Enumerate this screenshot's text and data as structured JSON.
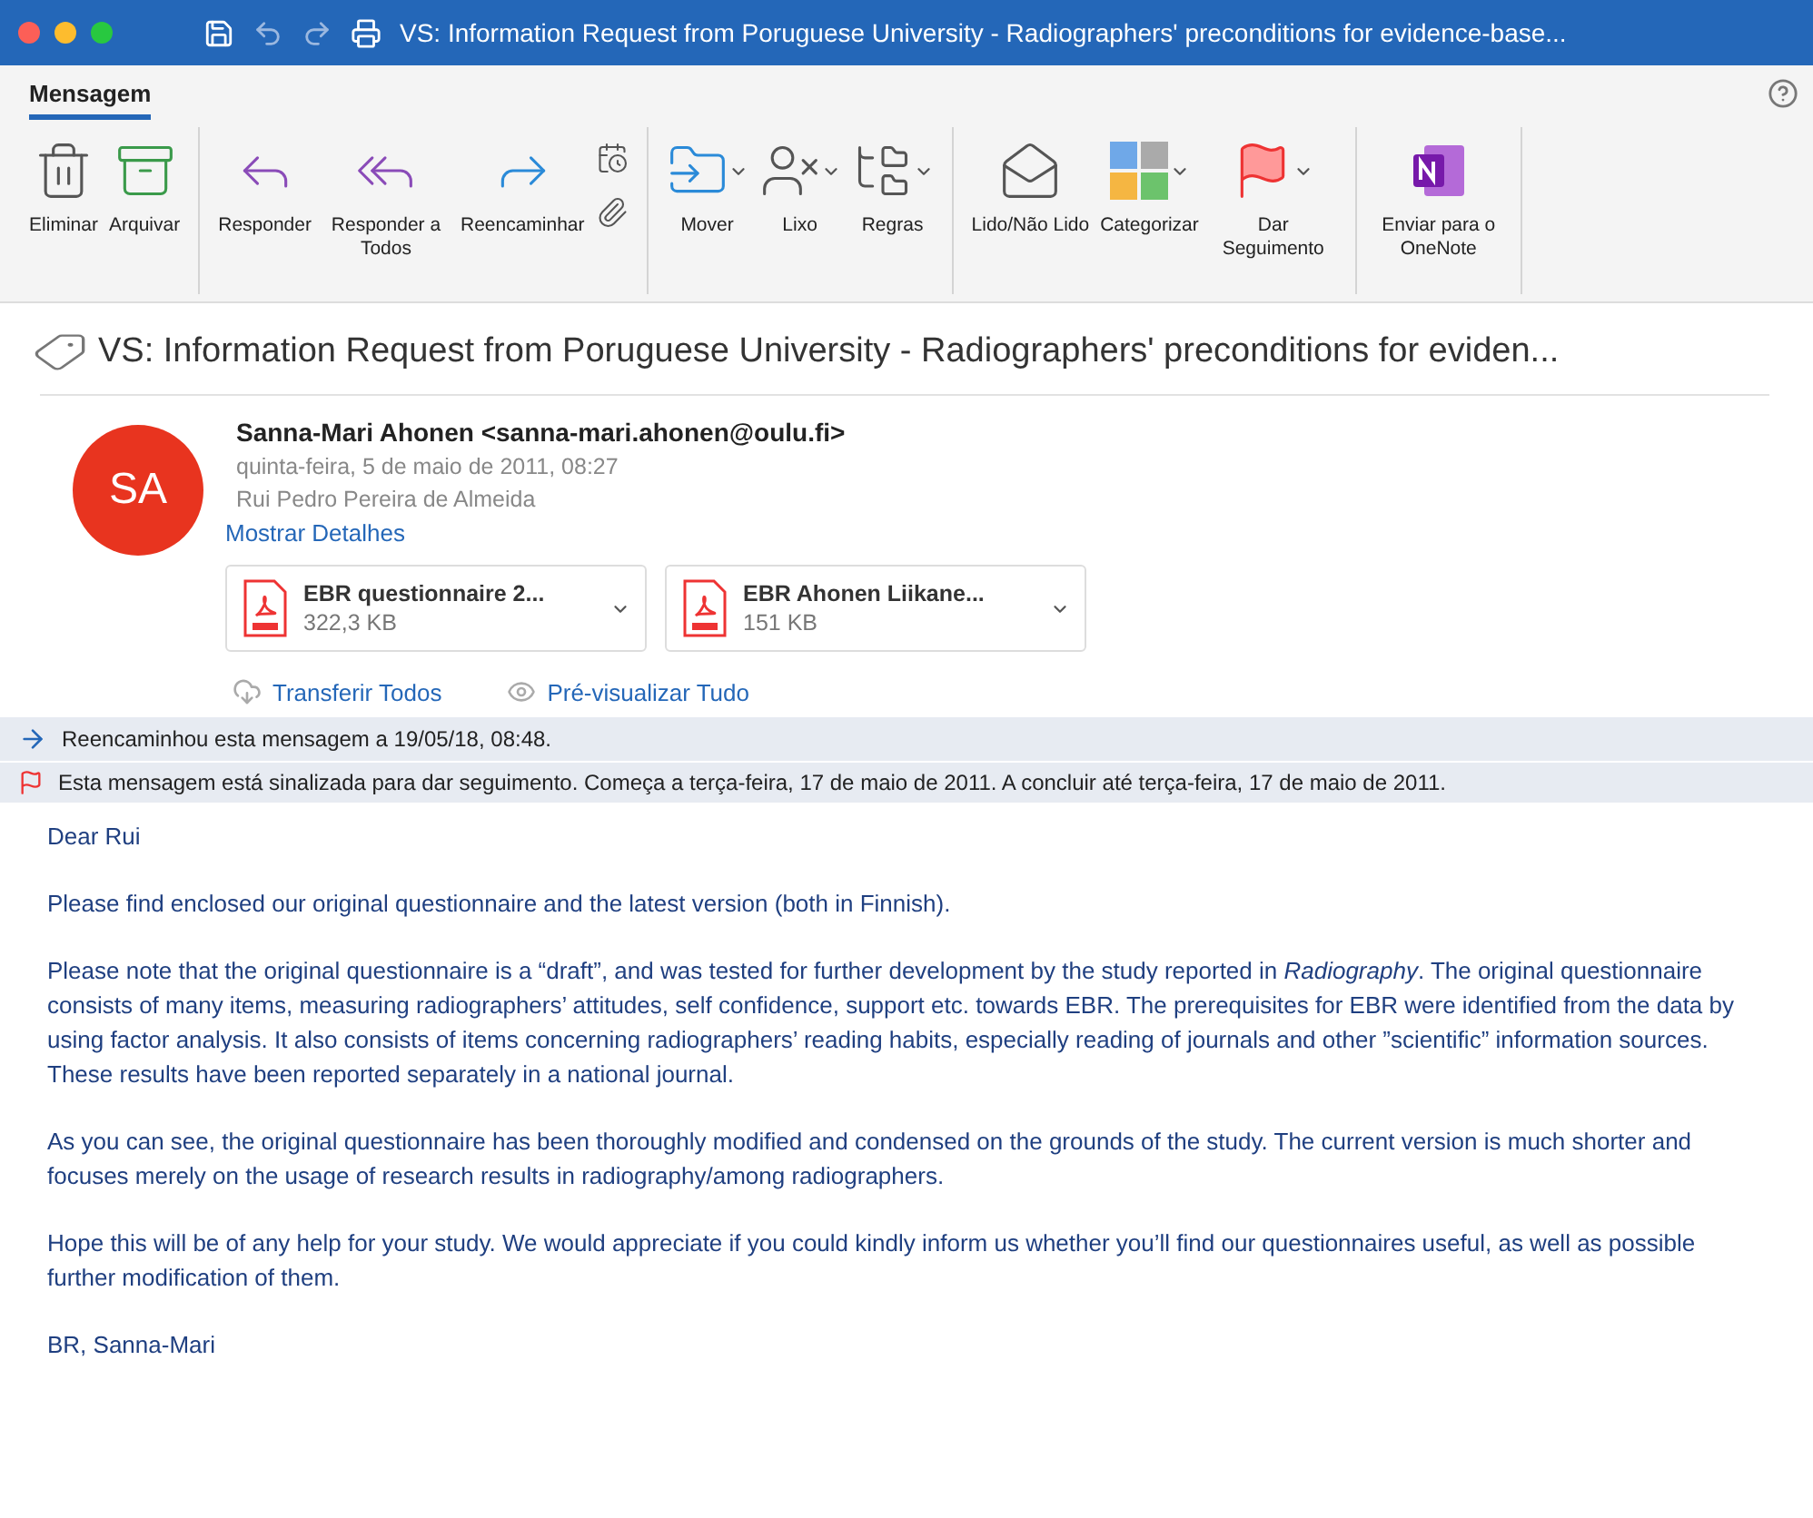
{
  "window": {
    "title": "VS: Information Request from Poruguese University - Radiographers' preconditions for evidence-base..."
  },
  "tabs": [
    {
      "label": "Mensagem",
      "selected": true
    }
  ],
  "ribbon": [
    [
      {
        "kind": "large",
        "label": "Eliminar",
        "dropdown": false
      },
      {
        "kind": "large",
        "label": "Arquivar",
        "dropdown": false
      }
    ],
    [
      {
        "kind": "large",
        "label": "Responder",
        "dropdown": false
      },
      {
        "kind": "large",
        "label": "Responder a Todos",
        "dropdown": false
      },
      {
        "kind": "large",
        "label": "Reencaminhar",
        "dropdown": false
      },
      {
        "kind": "stack"
      }
    ],
    [
      {
        "kind": "large",
        "label": "Mover",
        "dropdown": true
      },
      {
        "kind": "large",
        "label": "Lixo",
        "dropdown": true
      },
      {
        "kind": "large",
        "label": "Regras",
        "dropdown": true
      }
    ],
    [
      {
        "kind": "large",
        "label": "Lido/Não Lido",
        "dropdown": false
      },
      {
        "kind": "large",
        "label": "Categorizar",
        "dropdown": true
      },
      {
        "kind": "large",
        "label": "Dar Seguimento",
        "dropdown": true
      }
    ],
    [
      {
        "kind": "large",
        "label": "Enviar para o OneNote",
        "dropdown": false
      }
    ]
  ],
  "message": {
    "subject": "VS: Information Request from Poruguese University - Radiographers' preconditions for eviden...",
    "avatar": "SA",
    "sender": "Sanna-Mari Ahonen <sanna-mari.ahonen@oulu.fi>",
    "date": "quinta-feira, 5 de maio de 2011, 08:27",
    "to": "Rui Pedro Pereira de Almeida",
    "details_link": "Mostrar Detalhes",
    "attachments": [
      {
        "name": "EBR questionnaire 2...",
        "size": "322,3 KB"
      },
      {
        "name": "EBR Ahonen Liikane...",
        "size": "151 KB"
      }
    ],
    "actions": [
      "Transferir Todos",
      "Pré-visualizar Tudo"
    ],
    "notices": [
      {
        "kind": "forwarded",
        "text": "Reencaminhou esta mensagem a 19/05/18, 08:48."
      },
      {
        "kind": "flag",
        "text": "Esta mensagem está sinalizada para dar seguimento. Começa a terça-feira, 17 de maio de 2011. A concluir até terça-feira, 17 de maio de 2011."
      }
    ],
    "body": [
      "Dear Rui",
      "Please find enclosed our original questionnaire and the latest version (both in Finnish).",
      "Please note that the original questionnaire is a “draft”, and was tested for further development by the study reported in *Radiography*. The original questionnaire consists of many items, measuring radiographers’ attitudes, self confidence, support etc. towards EBR. The prerequisites for EBR were identified from the data by using factor analysis. It also consists of items concerning radiographers’ reading habits, especially reading of journals and other ”scientific” information sources. These results have been reported separately in a national journal.",
      "As you can see, the original questionnaire has been thoroughly modified and condensed on the grounds of the study. The current version is much shorter and focuses merely on the usage of research results in radiography/among radiographers.",
      "Hope this will be of any help for your study. We would appreciate if you could kindly inform us whether you’ll find our questionnaires useful, as well as possible further modification of them.",
      "BR, Sanna-Mari"
    ]
  }
}
